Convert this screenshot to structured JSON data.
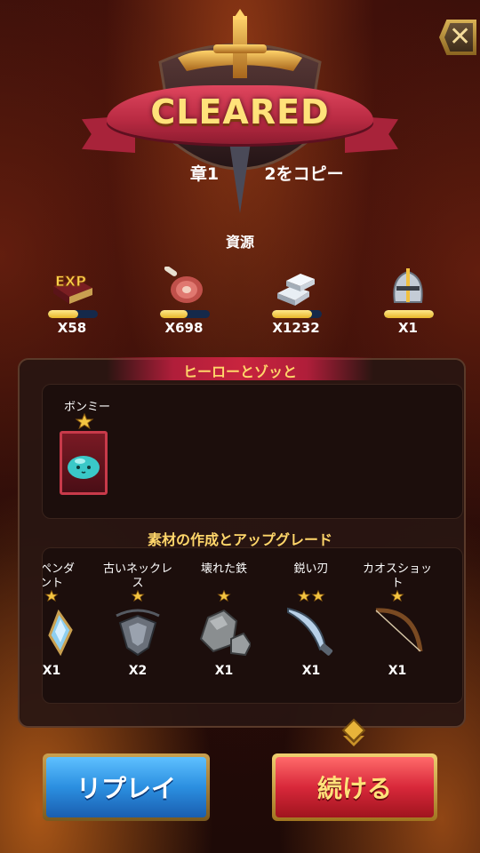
{
  "header": {
    "banner_text": "CLEARED",
    "chapter": "章1",
    "copy_label": "2をコピー"
  },
  "resources": {
    "title": "資源",
    "items": [
      {
        "icon": "exp-book-icon",
        "icon_label": "EXP",
        "fill": 0.6,
        "value": "X58"
      },
      {
        "icon": "meat-icon",
        "fill": 0.55,
        "value": "X698"
      },
      {
        "icon": "silver-ingot-icon",
        "fill": 0.8,
        "value": "X1232"
      },
      {
        "icon": "helmet-icon",
        "fill": 1.0,
        "value": "X1"
      }
    ]
  },
  "heroes": {
    "title": "ヒーローとゾッと",
    "list": [
      {
        "name": "ボンミー",
        "stars": 1,
        "icon": "blue-slime-icon"
      }
    ]
  },
  "materials": {
    "title": "素材の作成とアップグレード",
    "items": [
      {
        "name": "のペンダ\nント",
        "stars": 1,
        "icon": "crystal-pendant-icon",
        "qty": "X1"
      },
      {
        "name": "古いネックレ\nス",
        "stars": 1,
        "icon": "old-necklace-icon",
        "qty": "X2"
      },
      {
        "name": "壊れた鉄",
        "stars": 1,
        "icon": "broken-iron-icon",
        "qty": "X1"
      },
      {
        "name": "鋭い刃",
        "stars": 2,
        "icon": "sharp-blade-icon",
        "qty": "X1"
      },
      {
        "name": "カオスショッ\nト",
        "stars": 1,
        "icon": "bow-icon",
        "qty": "X1"
      }
    ]
  },
  "buttons": {
    "replay": "リプレイ",
    "continue": "続ける"
  },
  "colors": {
    "accent_gold": "#ffd66a",
    "banner_red": "#c8243e",
    "replay_blue": "#2b8fe0",
    "continue_red": "#d8283a"
  }
}
